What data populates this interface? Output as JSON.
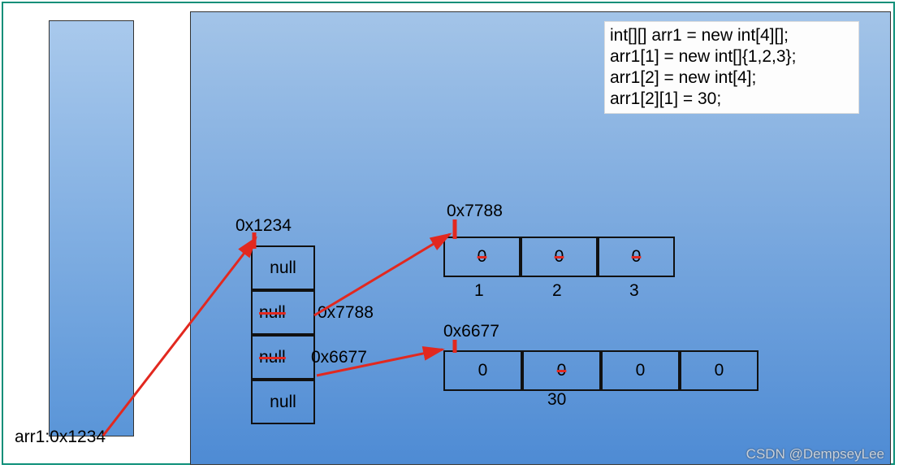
{
  "code": {
    "l1": "int[][] arr1 = new int[4][];",
    "l2": "arr1[1] = new int[]{1,2,3};",
    "l3": "arr1[2] = new int[4];",
    "l4": "arr1[2][1] = 30;"
  },
  "stack": {
    "varLabel": "arr1:0x1234"
  },
  "outerAddr": "0x1234",
  "outer": {
    "c0": "null",
    "c1": "null",
    "c2": "null",
    "c3": "null"
  },
  "outerOverride": {
    "c1": "0x7788",
    "c2": "0x6677"
  },
  "arr7788": {
    "addr": "0x7788",
    "old": {
      "v0": "0",
      "v1": "0",
      "v2": "0"
    },
    "new": {
      "v0": "1",
      "v1": "2",
      "v2": "3"
    }
  },
  "arr6677": {
    "addr": "0x6677",
    "v0": "0",
    "v1old": "0",
    "v1new": "30",
    "v2": "0",
    "v3": "0"
  },
  "watermark": "CSDN @DempseyLee"
}
